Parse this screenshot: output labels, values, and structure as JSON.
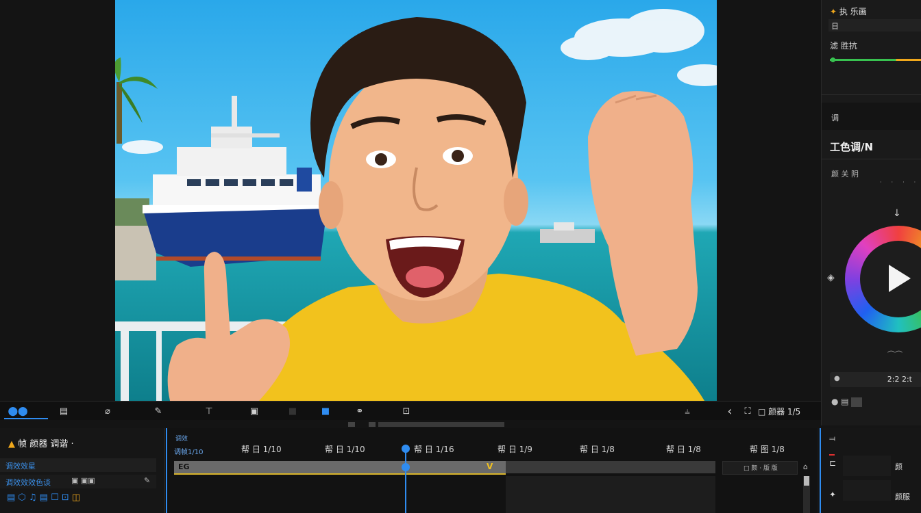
{
  "preview": {
    "subject": "excited man in yellow t-shirt pointing, ship in harbor behind"
  },
  "inspector": {
    "section1": {
      "title": "执 乐画",
      "row1": "日",
      "row2": "滤 胜抗"
    },
    "section2": {
      "header": "调",
      "title": "工色调/N",
      "row": "颜 关 阴"
    },
    "wheel": {
      "value": "2:2 2:t"
    }
  },
  "toolbar": {
    "right_label": "□ 颜器 1/5"
  },
  "timeline": {
    "panel_title": "帧 颜器 调谐",
    "track_label": "调效效星",
    "track_sub_label": "调效效效色谈",
    "header_small": "调效",
    "header_small2": "调帧1/10",
    "timecodes": [
      "帮 日 1/10",
      "帮 日 1/10",
      "帮 日 1/16",
      "帮 日 1/9",
      "帮 日 1/8",
      "帮 日 1/8",
      "帮 图 1/8"
    ],
    "clip_label": "EG",
    "clip_marker": "V",
    "side_field": "□ 颜 · 版 版",
    "right_labels": [
      "颜",
      "颜服"
    ]
  },
  "colors": {
    "accent_blue": "#2f8cf0",
    "playhead": "#2f8cf0",
    "shirt_yellow": "#f2c21d",
    "progress_green": "#38c250",
    "progress_orange": "#f0a81c"
  }
}
